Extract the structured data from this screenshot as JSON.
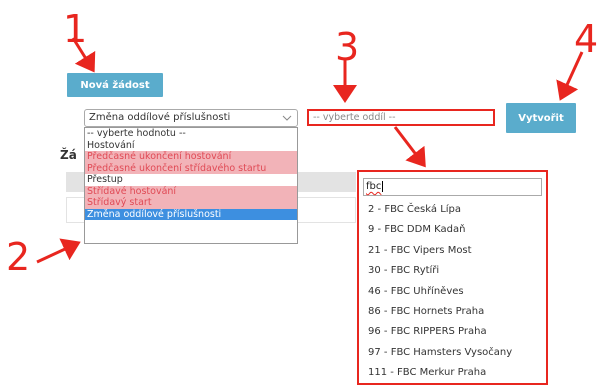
{
  "annotations": {
    "step1": "1",
    "step2": "2",
    "step3": "3",
    "step4": "4"
  },
  "buttons": {
    "new_request": "Nová žádost",
    "create": "Vytvořit"
  },
  "page": {
    "section_heading_fragment": "Žá"
  },
  "request_type": {
    "selected": "Změna oddílové příslušnosti",
    "options": [
      {
        "label": "-- vyberte hodnotu --",
        "state": "normal"
      },
      {
        "label": "Hostování",
        "state": "normal"
      },
      {
        "label": "Předčasné ukončení hostování",
        "state": "red"
      },
      {
        "label": "Předčasné ukončení střídavého startu",
        "state": "red"
      },
      {
        "label": "Přestup",
        "state": "normal"
      },
      {
        "label": "Střídavé hostování",
        "state": "red"
      },
      {
        "label": "Střídavý start",
        "state": "red"
      },
      {
        "label": "Změna oddílové příslušnosti",
        "state": "selected"
      }
    ]
  },
  "club_select": {
    "placeholder": "-- vyberte oddíl --",
    "search_value": "fbc",
    "results": [
      "2 - FBC Česká Lípa",
      "9 - FBC DDM Kadaň",
      "21 - FBC Vipers Most",
      "30 - FBC Rytíři",
      "46 - FBC Uhříněves",
      "86 - FBC Hornets Praha",
      "96 - FBC RIPPERS Praha",
      "97 - FBC Hamsters Vysočany",
      "111 - FBC Merkur Praha"
    ]
  },
  "colors": {
    "annotation_red": "#e8261f",
    "button_teal": "#5aaccc",
    "option_highlight": "#3d8fe0",
    "option_red_bg": "#f2b3b8"
  }
}
